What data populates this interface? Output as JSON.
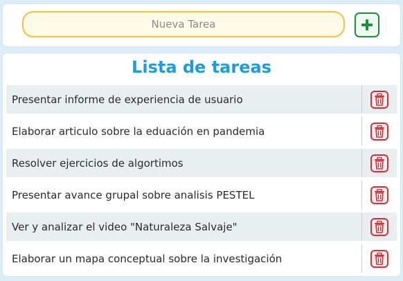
{
  "new_task": {
    "placeholder": "Nueva Tarea",
    "value": ""
  },
  "add_button": {
    "icon": "plus-icon",
    "color": "#1e8d3c"
  },
  "list": {
    "title": "Lista de tareas",
    "tasks": [
      "Presentar informe de experiencia de usuario",
      "Elaborar articulo sobre la eduación en pandemia",
      "Resolver ejercicios de algortimos",
      "Presentar avance grupal sobre analisis PESTEL",
      "Ver y analizar el video \"Naturaleza Salvaje\"",
      "Elaborar un mapa conceptual sobre la investigación"
    ],
    "delete_icon": "trash-icon",
    "delete_color": "#d2303a"
  },
  "colors": {
    "background": "#dbeef7",
    "title": "#1c9bdd",
    "input_border": "#f2c23d",
    "row_alt": "#e9eef1"
  }
}
